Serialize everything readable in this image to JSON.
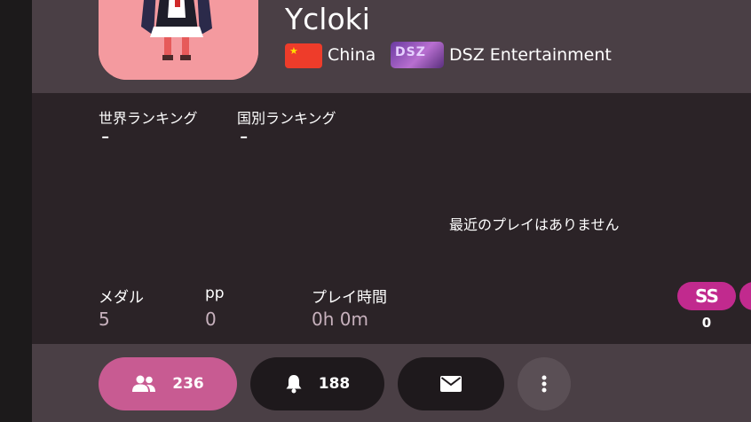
{
  "profile": {
    "username": "Ycloki",
    "country": "China",
    "team_flag_text": "DSZ",
    "team": "DSZ Entertainment"
  },
  "rankings": {
    "global_label": "世界ランキング",
    "global_value": "-",
    "country_label": "国別ランキング",
    "country_value": "-"
  },
  "recent": {
    "empty_message": "最近のプレイはありません"
  },
  "stats": {
    "medals_label": "メダル",
    "medals_value": "5",
    "pp_label": "pp",
    "pp_value": "0",
    "playtime_label": "プレイ時間",
    "playtime_value": "0h 0m"
  },
  "grades": {
    "ss_label": "SS",
    "ss_count": "0"
  },
  "actions": {
    "friends_count": "236",
    "followers_count": "188"
  },
  "colors": {
    "accent_pink": "#c85b92",
    "grade_ss": "#c12a8e",
    "header_bg": "#4a3f45",
    "panel_bg": "#2b2327"
  },
  "icons": [
    "friends-icon",
    "bell-icon",
    "mail-icon",
    "more-vertical-icon",
    "china-flag-icon"
  ]
}
